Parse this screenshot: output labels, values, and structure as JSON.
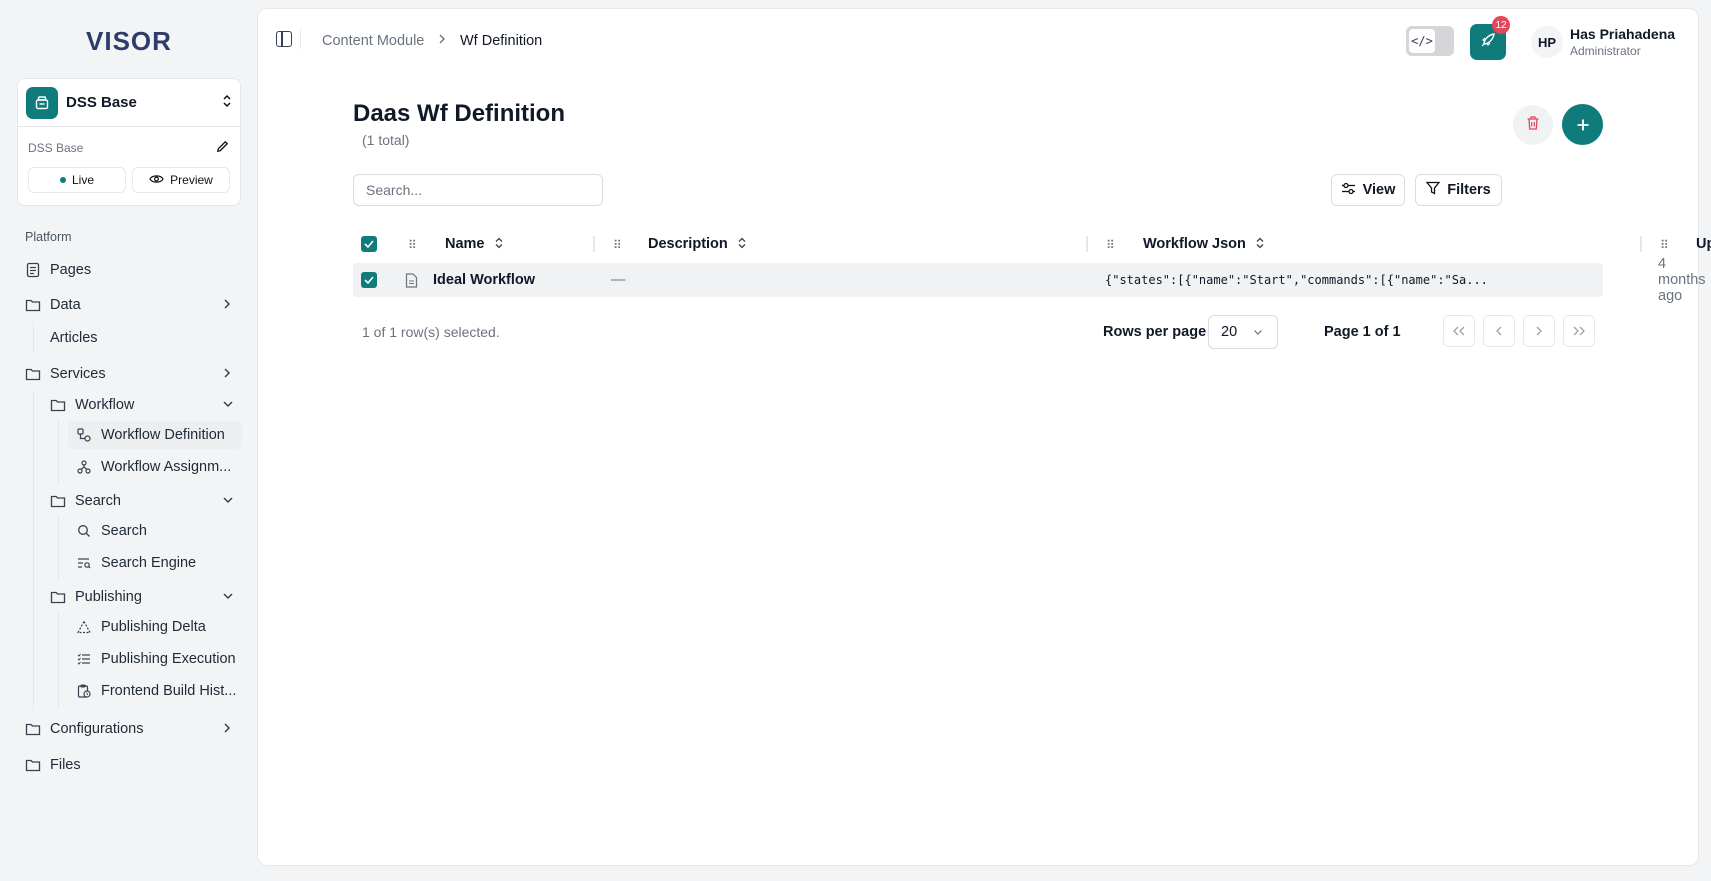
{
  "brand": {
    "logo": "VISOR",
    "accent": "#0f7b7b",
    "danger": "#e4475a"
  },
  "workspace": {
    "name": "DSS Base",
    "subtitle": "DSS Base",
    "live_label": "Live",
    "preview_label": "Preview"
  },
  "sidebar": {
    "section": "Platform",
    "items": {
      "pages": "Pages",
      "data": "Data",
      "articles": "Articles",
      "services": "Services",
      "workflow": "Workflow",
      "workflow_definition": "Workflow Definition",
      "workflow_assignment": "Workflow Assignm...",
      "search_group": "Search",
      "search": "Search",
      "search_engine": "Search Engine",
      "publishing": "Publishing",
      "publishing_delta": "Publishing Delta",
      "publishing_execution": "Publishing Execution",
      "frontend_build": "Frontend Build Hist...",
      "configurations": "Configurations",
      "files": "Files"
    }
  },
  "breadcrumb": {
    "parent": "Content Module",
    "current": "Wf Definition"
  },
  "topbar": {
    "code_icon": "</>",
    "notification_count": "12",
    "user_initials": "HP",
    "user_name": "Has Priahadena",
    "user_role": "Administrator"
  },
  "page": {
    "title": "Daas Wf Definition",
    "count": "(1 total)",
    "search_placeholder": "Search...",
    "view_label": "View",
    "filters_label": "Filters"
  },
  "table": {
    "columns": {
      "name": "Name",
      "description": "Description",
      "workflow_json": "Workflow Json",
      "updated": "Updated"
    },
    "rows": [
      {
        "name": "Ideal Workflow",
        "description": "—",
        "workflow_json": "{\"states\":[{\"name\":\"Start\",\"commands\":[{\"name\":\"Sa...",
        "updated": "4 months ago",
        "selected": true
      }
    ]
  },
  "footer": {
    "selected_text": "1 of 1 row(s) selected.",
    "rows_per_page_label": "Rows per page",
    "rows_per_page_value": "20",
    "page_label": "Page 1 of 1"
  }
}
